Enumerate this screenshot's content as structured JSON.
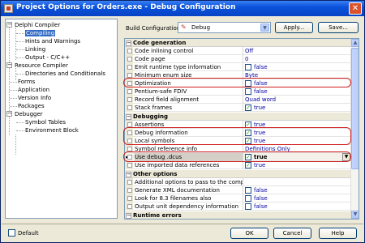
{
  "window": {
    "title": "Project Options for Orders.exe - Debug Configuration",
    "close_glyph": "✕"
  },
  "tree": {
    "items": [
      {
        "label": "Delphi Compiler",
        "expander": "−"
      },
      {
        "label": "Compiling",
        "selected": true
      },
      {
        "label": "Hints and Warnings"
      },
      {
        "label": "Linking"
      },
      {
        "label": "Output - C/C++"
      },
      {
        "label": "Resource Compiler",
        "expander": "−"
      },
      {
        "label": "Directories and Conditionals"
      },
      {
        "label": "Forms"
      },
      {
        "label": "Application"
      },
      {
        "label": "Version Info"
      },
      {
        "label": "Packages"
      },
      {
        "label": "Debugger",
        "expander": "−"
      },
      {
        "label": "Symbol Tables"
      },
      {
        "label": "Environment Block"
      }
    ]
  },
  "build_config": {
    "label": "Build Configuration:",
    "value": "Debug",
    "icon": "pencil-icon"
  },
  "buttons": {
    "apply": "Apply...",
    "save": "Save...",
    "ok": "OK",
    "cancel": "Cancel",
    "help": "Help"
  },
  "grid": {
    "categories": {
      "code_generation": "Code generation",
      "debugging": "Debugging",
      "other_options": "Other options",
      "runtime_errors": "Runtime errors"
    },
    "rows": {
      "code_inlining": {
        "name": "Code inlining control",
        "value": "Off"
      },
      "code_page": {
        "name": "Code page",
        "value": "0"
      },
      "emit_rtti": {
        "name": "Emit runtime type information",
        "value": "false"
      },
      "min_enum": {
        "name": "Minimum enum size",
        "value": "Byte"
      },
      "optimization": {
        "name": "Optimization",
        "value": "false"
      },
      "pentium_fdiv": {
        "name": "Pentium-safe FDIV",
        "value": "false"
      },
      "record_align": {
        "name": "Record field alignment",
        "value": "Quad word"
      },
      "stack_frames": {
        "name": "Stack frames",
        "value": "true"
      },
      "assertions": {
        "name": "Assertions",
        "value": "true"
      },
      "debug_info": {
        "name": "Debug information",
        "value": "true"
      },
      "local_symbols": {
        "name": "Local symbols",
        "value": "true"
      },
      "symbol_ref": {
        "name": "Symbol reference info",
        "value": "Definitions Only"
      },
      "use_debug_dcus": {
        "name": "Use debug .dcus",
        "value": "true"
      },
      "use_imported": {
        "name": "Use imported data references",
        "value": "true"
      },
      "additional": {
        "name": "Additional options to pass to the compiler",
        "value": ""
      },
      "gen_xml": {
        "name": "Generate XML documentation",
        "value": "false"
      },
      "look_83": {
        "name": "Look for 8.3 filenames also",
        "value": "false"
      },
      "output_deps": {
        "name": "Output unit dependency information",
        "value": "false"
      }
    }
  },
  "footer": {
    "default_label": "Default"
  }
}
